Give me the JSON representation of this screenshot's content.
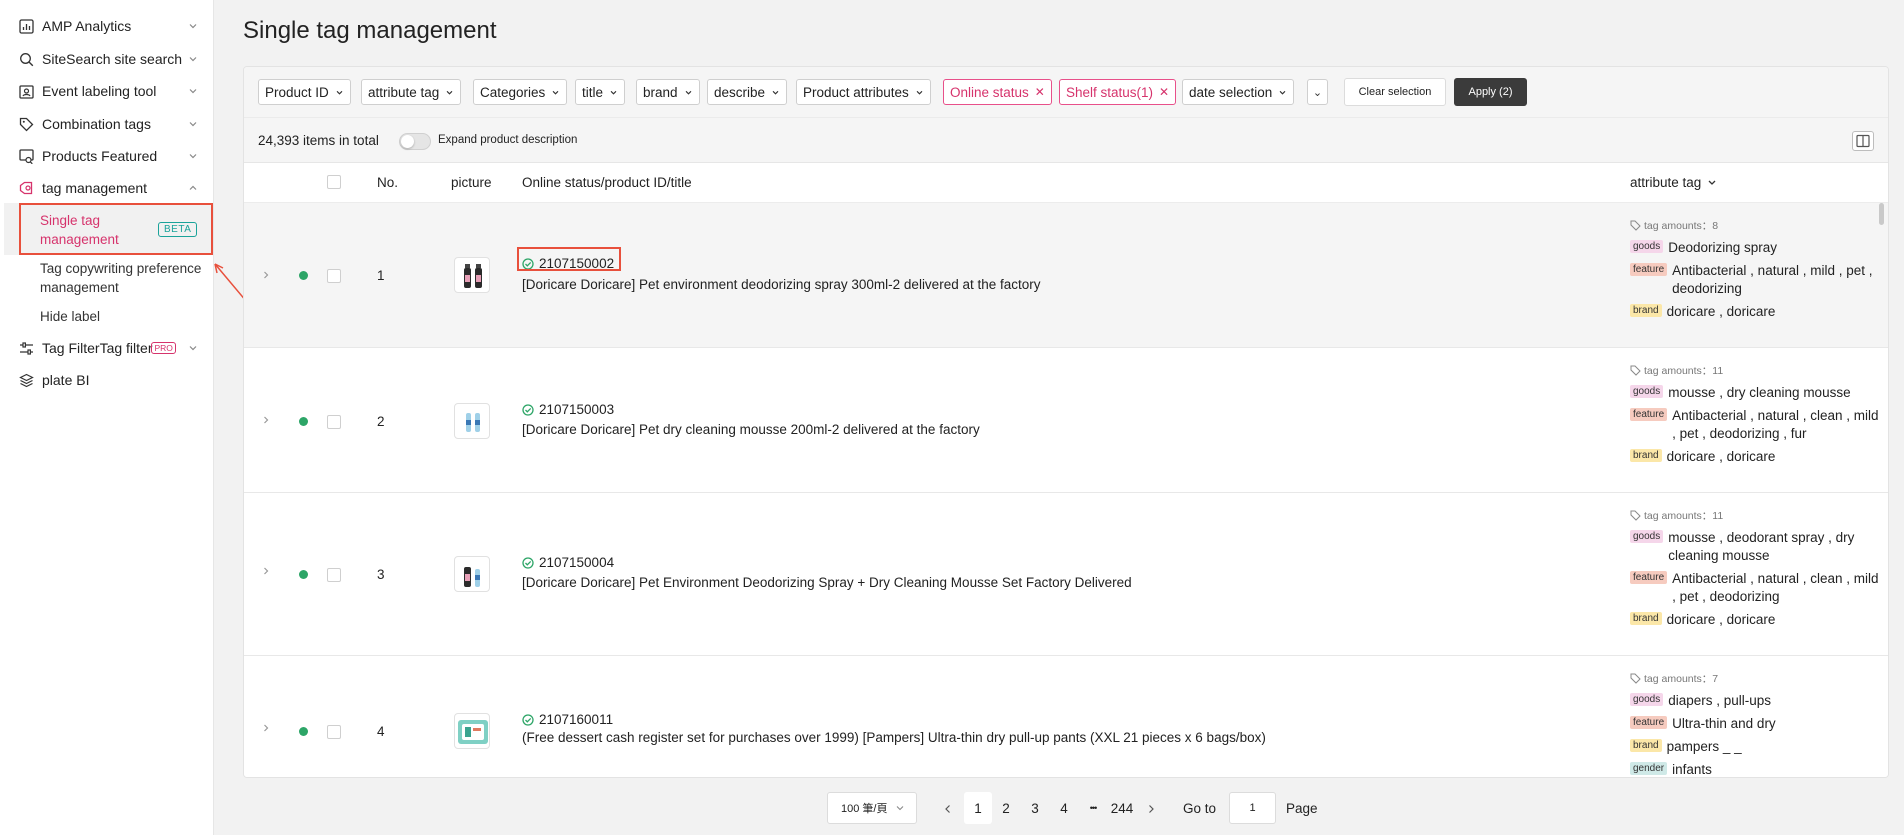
{
  "page": {
    "title": "Single tag management"
  },
  "sidebar": {
    "items": [
      {
        "label": "AMP Analytics"
      },
      {
        "label": "SiteSearch site search"
      },
      {
        "label": "Event labeling tool"
      },
      {
        "label": "Combination tags"
      },
      {
        "label": "Products Featured"
      },
      {
        "label": "tag management"
      },
      {
        "label": "Tag FilterTag filter",
        "badge": "PRO"
      },
      {
        "label": "plate BI"
      }
    ],
    "sub_items": [
      {
        "label": "Single tag management",
        "badge": "BETA"
      },
      {
        "label": "Tag copywriting preference management"
      },
      {
        "label": "Hide label"
      }
    ]
  },
  "filters": {
    "items": [
      "Product ID",
      "attribute tag",
      "Categories",
      "title",
      "brand",
      "describe",
      "Product attributes"
    ],
    "active": [
      "Online status",
      "Shelf status(1)"
    ],
    "date": "date selection",
    "more": "⌄",
    "clear_label": "Clear selection",
    "apply_label": "Apply (2)"
  },
  "info": {
    "total": "24,393 items in total",
    "expand_label": "Expand product description"
  },
  "table": {
    "headers": {
      "no": "No.",
      "picture": "picture",
      "main": "Online status/product ID/title",
      "tags": "attribute tag"
    },
    "rows": [
      {
        "no": "1",
        "id": "2107150002",
        "title": "[Doricare Doricare] Pet environment deodorizing spray 300ml-2 delivered at the factory",
        "tag_amount": "tag amounts：8",
        "tags": [
          {
            "type": "goods",
            "value": "Deodorizing spray"
          },
          {
            "type": "feature",
            "value": "Antibacterial , natural , mild , pet , deodorizing"
          },
          {
            "type": "brand",
            "value": "doricare , doricare"
          }
        ]
      },
      {
        "no": "2",
        "id": "2107150003",
        "title": "[Doricare Doricare] Pet dry cleaning mousse 200ml-2 delivered at the factory",
        "tag_amount": "tag amounts：11",
        "tags": [
          {
            "type": "goods",
            "value": "mousse , dry cleaning mousse"
          },
          {
            "type": "feature",
            "value": "Antibacterial , natural , clean , mild , pet , deodorizing , fur"
          },
          {
            "type": "brand",
            "value": "doricare , doricare"
          }
        ]
      },
      {
        "no": "3",
        "id": "2107150004",
        "title": "[Doricare Doricare] Pet Environment Deodorizing Spray + Dry Cleaning Mousse Set Factory Delivered",
        "tag_amount": "tag amounts：11",
        "tags": [
          {
            "type": "goods",
            "value": "mousse , deodorant spray , dry cleaning mousse"
          },
          {
            "type": "feature",
            "value": "Antibacterial , natural , clean , mild , pet , deodorizing"
          },
          {
            "type": "brand",
            "value": "doricare , doricare"
          }
        ]
      },
      {
        "no": "4",
        "id": "2107160011",
        "title": "(Free dessert cash register set for purchases over 1999) [Pampers] Ultra-thin dry pull-up pants (XXL 21 pieces x 6 bags/box)",
        "tag_amount": "tag amounts：7",
        "tags": [
          {
            "type": "goods",
            "value": "diapers , pull-ups"
          },
          {
            "type": "feature",
            "value": "Ultra-thin and dry"
          },
          {
            "type": "brand",
            "value": "pampers _ _"
          },
          {
            "type": "gender",
            "value": "infants"
          }
        ]
      }
    ]
  },
  "pagination": {
    "page_size": "100 筆/頁",
    "pages": [
      "1",
      "2",
      "3",
      "4"
    ],
    "ellipsis": "•••",
    "last": "244",
    "goto_label": "Go to",
    "goto_value": "1",
    "page_label": "Page"
  },
  "colors": {
    "accent": "#d6336c",
    "online": "#2da567",
    "highlight": "#e8503c",
    "apply": "#3b3b3b"
  }
}
